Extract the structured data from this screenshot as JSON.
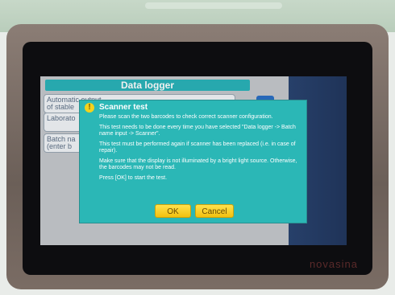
{
  "app": {
    "title": "Data logger",
    "rows": [
      {
        "label_line1": "Automatic output",
        "label_line2": "of stable"
      },
      {
        "label_line1": "Laborato",
        "label_line2": ""
      },
      {
        "label_line1": "Batch na",
        "label_line2": "(enter b"
      }
    ]
  },
  "dialog": {
    "title": "Scanner test",
    "icon": "info-icon",
    "paragraphs": [
      "Please scan the two barcodes to check correct scanner configuration.",
      "This test needs to be done every time you have selected \"Data logger -> Batch name input -> Scanner\".",
      "This test must be performed again if scanner has been replaced (i.e. in case of repair).",
      "Make sure that the display is not illuminated by a bright light source. Otherwise, the barcodes may not be read.",
      "Press [OK] to start the test."
    ],
    "ok_label": "OK",
    "cancel_label": "Cancel"
  },
  "device": {
    "brand": "novasina"
  },
  "colors": {
    "dialog": "#2bb7b6",
    "button": "#f2c10f",
    "title_bar": "#2ab3b9"
  }
}
